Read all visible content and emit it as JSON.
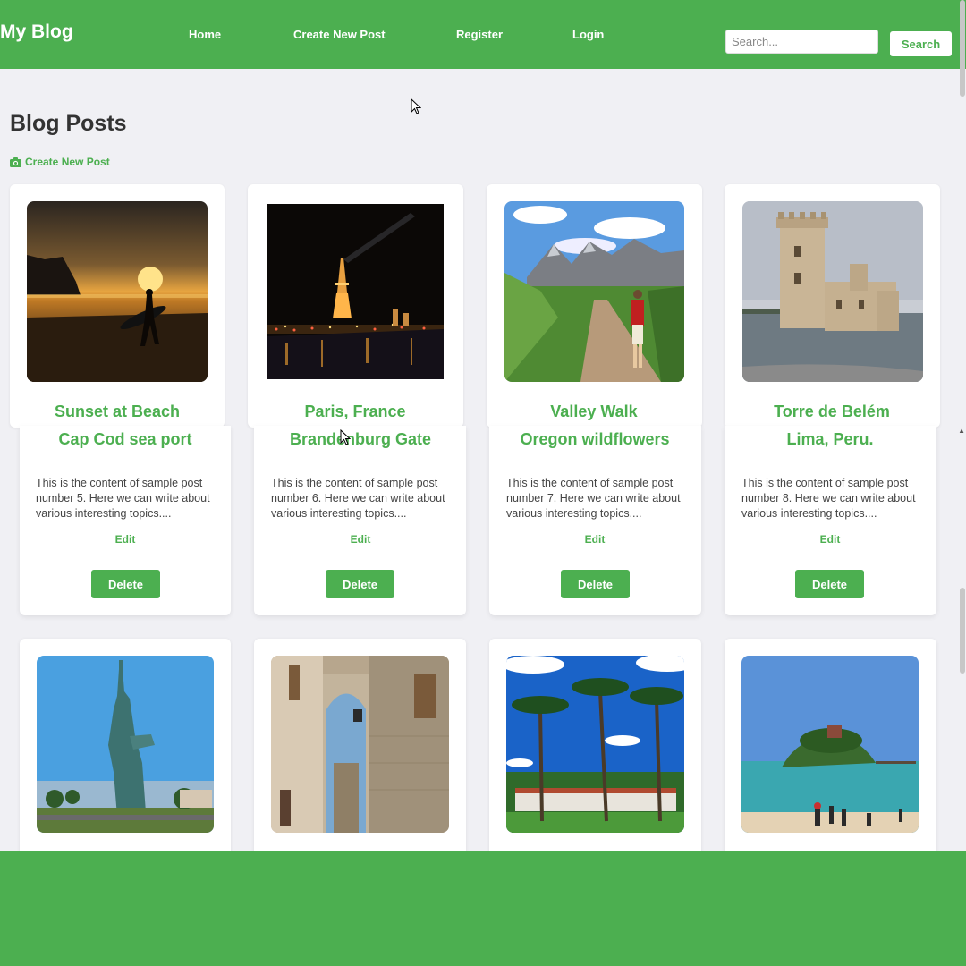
{
  "header": {
    "brand": "My Blog",
    "nav": [
      "Home",
      "Create New Post",
      "Register",
      "Login"
    ],
    "search_placeholder": "Search...",
    "search_button": "Search"
  },
  "main": {
    "title": "Blog Posts",
    "create_link": "Create New Post"
  },
  "posts": [
    {
      "title": "Sunset at Beach",
      "subtitle": "Cap Cod sea port",
      "body": "This is the content of sample post number 5. Here we can write about various interesting topics....",
      "edit": "Edit",
      "delete": "Delete",
      "photo": "sunset-surfer-photo"
    },
    {
      "title": "Paris, France",
      "subtitle": "Brandenburg Gate",
      "body": "This is the content of sample post number 6. Here we can write about various interesting topics....",
      "edit": "Edit",
      "delete": "Delete",
      "photo": "eiffel-tower-night-photo"
    },
    {
      "title": "Valley Walk",
      "subtitle": "Oregon wildflowers",
      "body": "This is the content of sample post number 7. Here we can write about various interesting topics....",
      "edit": "Edit",
      "delete": "Delete",
      "photo": "mountain-hiker-photo"
    },
    {
      "title": "Torre de Belém",
      "subtitle": "Lima, Peru.",
      "body": "This is the content of sample post number 8. Here we can write about various interesting topics....",
      "edit": "Edit",
      "delete": "Delete",
      "photo": "tower-belem-photo"
    }
  ],
  "second_row_photos": [
    "statue-of-liberty-photo",
    "stone-alley-photo",
    "palm-trees-photo",
    "island-beach-photo"
  ],
  "colors": {
    "accent": "#4caf50",
    "background": "#f0f0f4"
  }
}
